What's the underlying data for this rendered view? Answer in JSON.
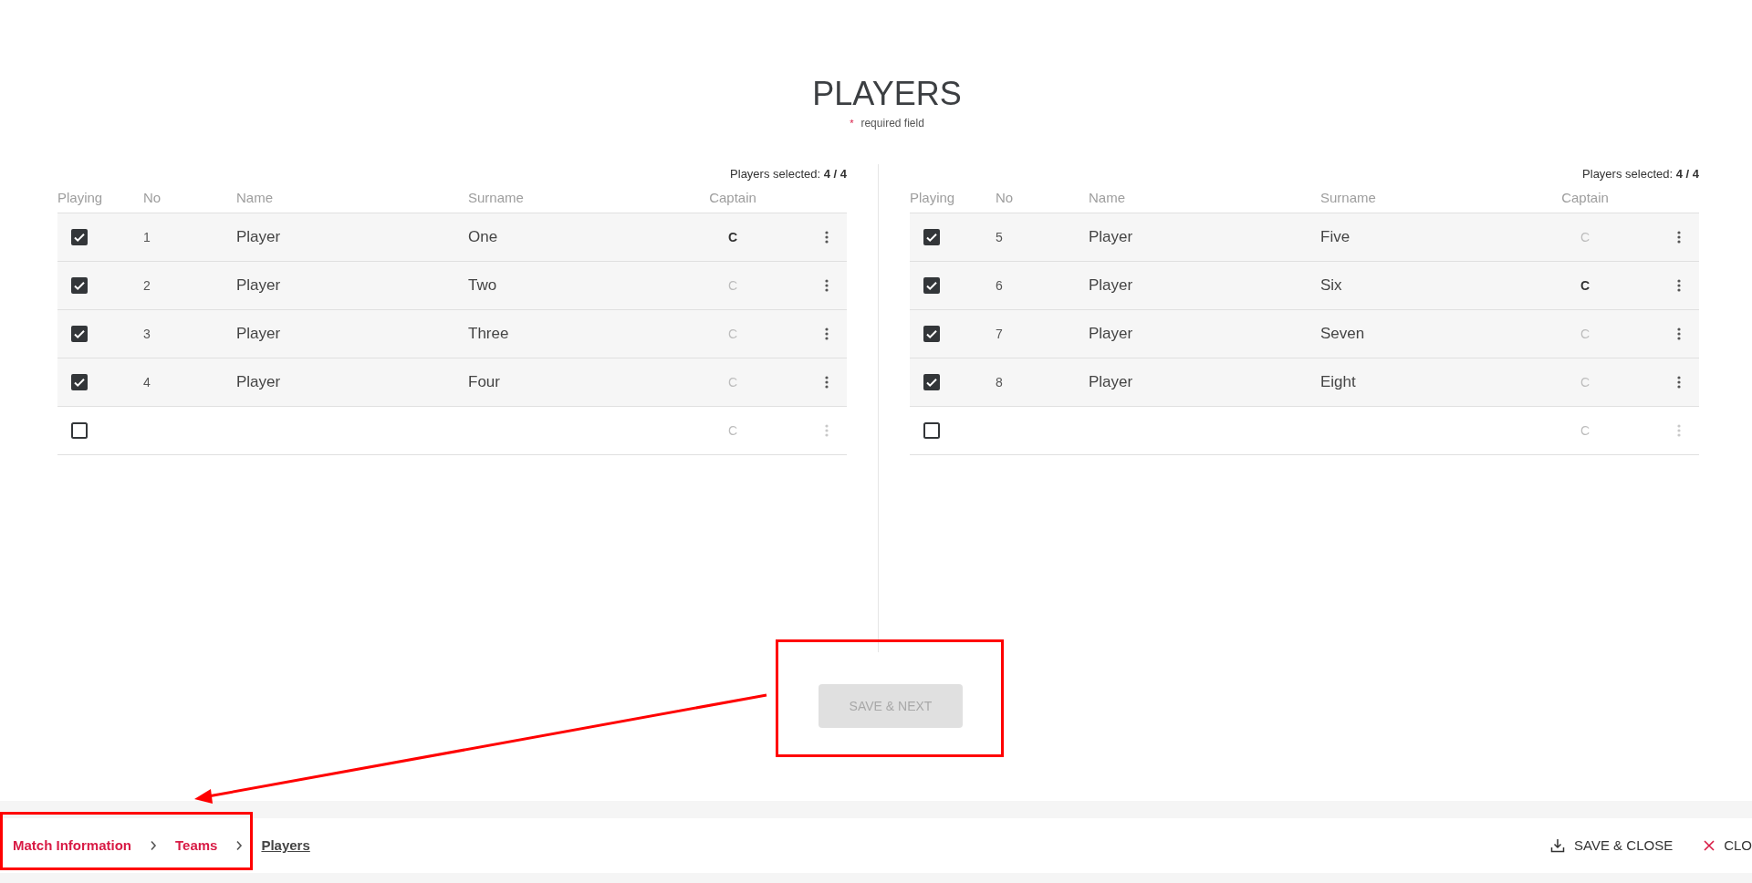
{
  "title": "PLAYERS",
  "required_note": {
    "mark": "*",
    "text": "required field"
  },
  "teams": [
    {
      "selected_label": "Players selected:",
      "selected_count": "4 / 4",
      "columns": [
        "Playing",
        "No",
        "Name",
        "Surname",
        "Captain"
      ],
      "rows": [
        {
          "checked": true,
          "no": "1",
          "name": "Player",
          "surname": "One",
          "captain": "C",
          "captain_selected": true,
          "menu_disabled": false
        },
        {
          "checked": true,
          "no": "2",
          "name": "Player",
          "surname": "Two",
          "captain": "C",
          "captain_selected": false,
          "menu_disabled": false
        },
        {
          "checked": true,
          "no": "3",
          "name": "Player",
          "surname": "Three",
          "captain": "C",
          "captain_selected": false,
          "menu_disabled": false
        },
        {
          "checked": true,
          "no": "4",
          "name": "Player",
          "surname": "Four",
          "captain": "C",
          "captain_selected": false,
          "menu_disabled": false
        },
        {
          "checked": false,
          "captain": "C",
          "captain_selected": false,
          "menu_disabled": true
        }
      ]
    },
    {
      "selected_label": "Players selected:",
      "selected_count": "4 / 4",
      "columns": [
        "Playing",
        "No",
        "Name",
        "Surname",
        "Captain"
      ],
      "rows": [
        {
          "checked": true,
          "no": "5",
          "name": "Player",
          "surname": "Five",
          "captain": "C",
          "captain_selected": false,
          "menu_disabled": false
        },
        {
          "checked": true,
          "no": "6",
          "name": "Player",
          "surname": "Six",
          "captain": "C",
          "captain_selected": true,
          "menu_disabled": false
        },
        {
          "checked": true,
          "no": "7",
          "name": "Player",
          "surname": "Seven",
          "captain": "C",
          "captain_selected": false,
          "menu_disabled": false
        },
        {
          "checked": true,
          "no": "8",
          "name": "Player",
          "surname": "Eight",
          "captain": "C",
          "captain_selected": false,
          "menu_disabled": false
        },
        {
          "checked": false,
          "captain": "C",
          "captain_selected": false,
          "menu_disabled": true
        }
      ]
    }
  ],
  "save_next_button": {
    "label": "SAVE & NEXT",
    "disabled": true
  },
  "breadcrumbs": [
    {
      "label": "Match Information",
      "current": false
    },
    {
      "label": "Teams",
      "current": false
    },
    {
      "label": "Players",
      "current": true
    }
  ],
  "actions": [
    {
      "kind": "save",
      "label": "SAVE & CLOSE"
    },
    {
      "kind": "close",
      "label": "CLO"
    }
  ]
}
